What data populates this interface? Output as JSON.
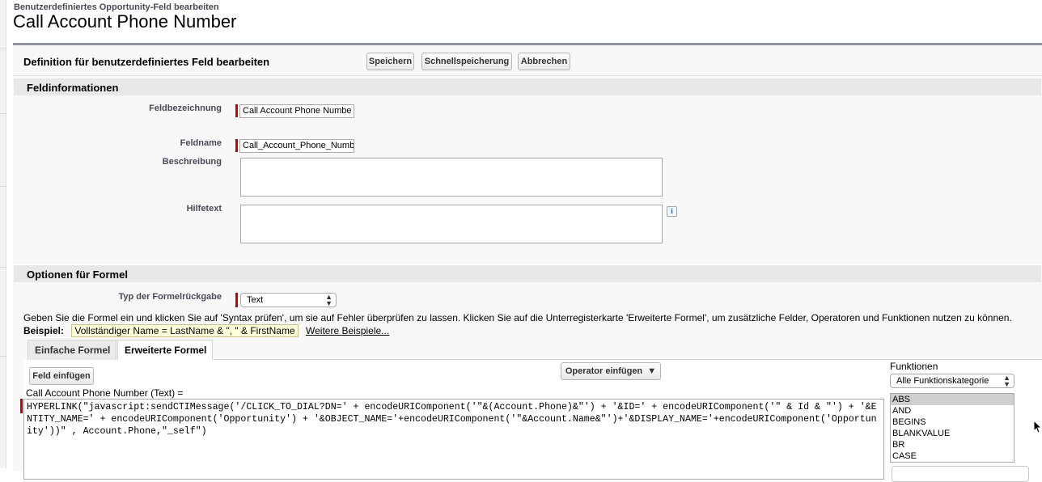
{
  "header": {
    "breadcrumb": "Benutzerdefiniertes Opportunity-Feld bearbeiten",
    "title": "Call Account Phone Number"
  },
  "pageblock": {
    "title": "Definition für benutzerdefiniertes Feld bearbeiten",
    "buttons": {
      "save": "Speichern",
      "quicksave": "Schnellspeicherung",
      "cancel": "Abbrechen"
    }
  },
  "field_info": {
    "section_title": "Feldinformationen",
    "label_label": "Feldbezeichnung",
    "label_value": "Call Account Phone Numbe",
    "name_label": "Feldname",
    "name_value": "Call_Account_Phone_Numb",
    "description_label": "Beschreibung",
    "help_label": "Hilfetext",
    "info_icon": "i"
  },
  "formula_options": {
    "section_title": "Optionen für Formel",
    "return_type_label": "Typ der Formelrückgabe",
    "return_type_value": "Text",
    "hint": "Geben Sie die Formel ein und klicken Sie auf 'Syntax prüfen', um sie auf Fehler überprüfen zu lassen. Klicken Sie auf die Unterregisterkarte 'Erweiterte Formel', um zusätzliche Felder, Operatoren und Funktionen nutzen zu können.",
    "example_label": "Beispiel:",
    "example_value": "Vollständiger Name = LastName & \", \" & FirstName",
    "more_examples": "Weitere Beispiele..."
  },
  "tabs": {
    "simple": "Einfache Formel",
    "advanced": "Erweiterte Formel"
  },
  "editor": {
    "insert_field": "Feld einfügen",
    "insert_operator": "Operator einfügen",
    "formula_label": "Call Account Phone Number (Text) =",
    "formula": "HYPERLINK(\"javascript:sendCTIMessage('/CLICK_TO_DIAL?DN=' + encodeURIComponent('\"&(Account.Phone)&\"') + '&ID=' + encodeURIComponent('\" & Id & \"') + '&ENTITY_NAME=' + encodeURIComponent('Opportunity') + '&OBJECT_NAME='+encodeURIComponent('\"&Account.Name&\"')+'&DISPLAY_NAME='+encodeURIComponent('Opportunity'))\" , Account.Phone,\"_self\")",
    "functions_label": "Funktionen",
    "function_category": "Alle Funktionskategorie",
    "functions": [
      "ABS",
      "AND",
      "BEGINS",
      "BLANKVALUE",
      "BR",
      "CASE"
    ]
  }
}
